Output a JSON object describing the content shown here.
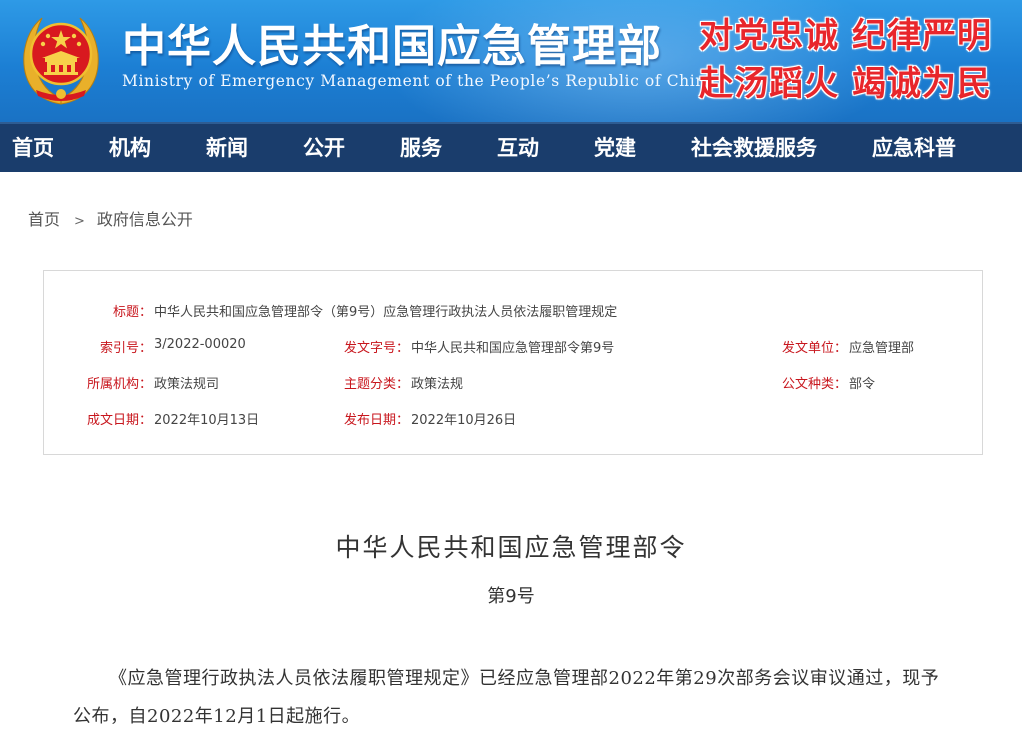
{
  "header": {
    "title_cn": "中华人民共和国应急管理部",
    "title_en": "Ministry of Emergency Management of the People’s Republic of China",
    "slogan_line1": "对党忠诚 纪律严明",
    "slogan_line2": "赴汤蹈火 竭诚为民",
    "emblem": "national-emblem",
    "colors": {
      "header_blue": "#1c7fd4",
      "nav_navy": "#1a3d6c",
      "slogan_red": "#e8262b",
      "label_red": "#c8161d"
    }
  },
  "nav": {
    "items": [
      "首页",
      "机构",
      "新闻",
      "公开",
      "服务",
      "互动",
      "党建",
      "社会救援服务",
      "应急科普"
    ]
  },
  "breadcrumb": {
    "home": "首页",
    "separator": ">",
    "current": "政府信息公开"
  },
  "meta": {
    "title_label": "标题：",
    "title_value": "中华人民共和国应急管理部令（第9号）应急管理行政执法人员依法履职管理规定",
    "index_label": "索引号：",
    "index_value": "3/2022-00020",
    "doc_no_label": "发文字号：",
    "doc_no_value": "中华人民共和国应急管理部令第9号",
    "issuer_label": "发文单位：",
    "issuer_value": "应急管理部",
    "org_label": "所属机构：",
    "org_value": "政策法规司",
    "topic_label": "主题分类：",
    "topic_value": "政策法规",
    "type_label": "公文种类：",
    "type_value": "部令",
    "created_label": "成文日期：",
    "created_value": "2022年10月13日",
    "published_label": "发布日期：",
    "published_value": "2022年10月26日"
  },
  "document": {
    "title": "中华人民共和国应急管理部令",
    "number": "第9号",
    "paragraph": "《应急管理行政执法人员依法履职管理规定》已经应急管理部2022年第29次部务会议审议通过，现予公布，自2022年12月1日起施行。"
  }
}
